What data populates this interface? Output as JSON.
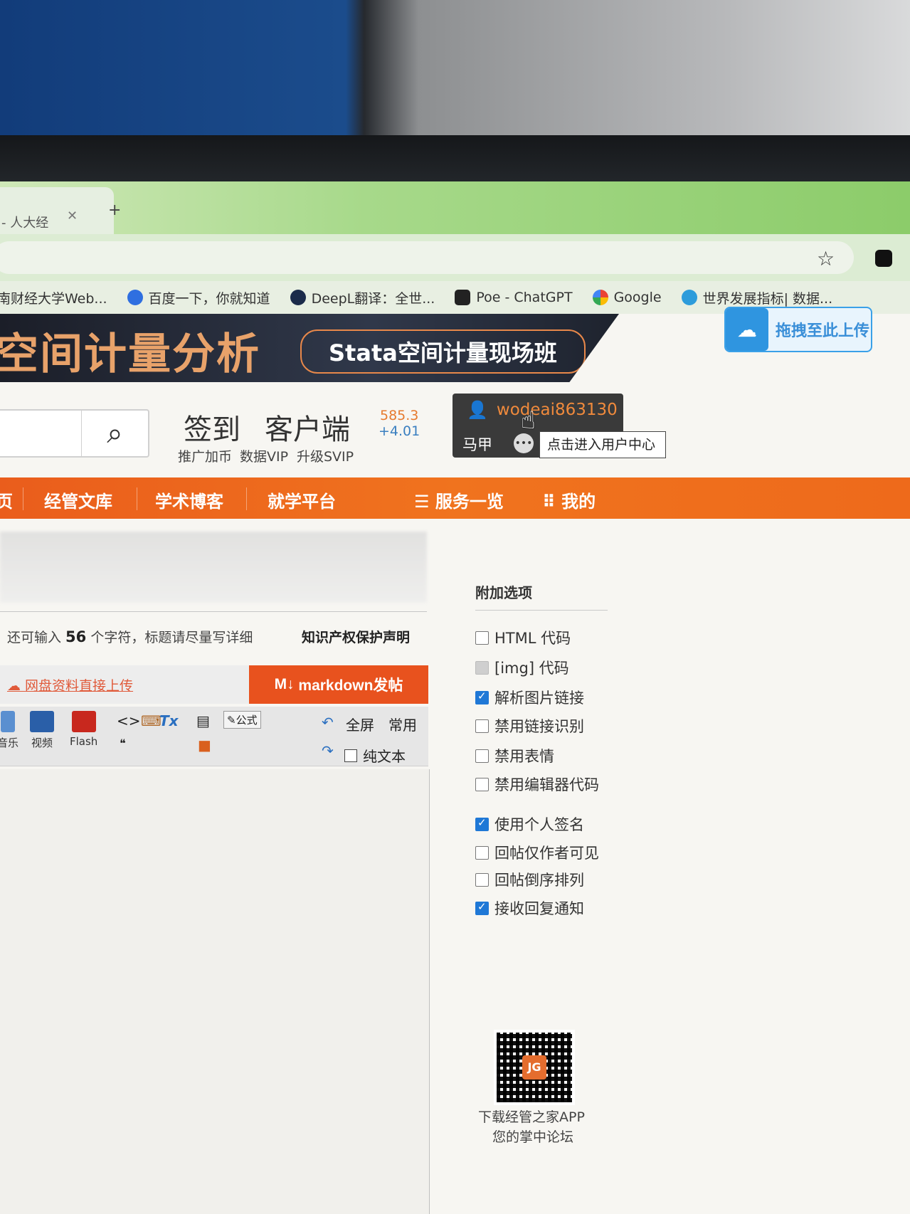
{
  "browser": {
    "tab_title": "- 人大经",
    "address_value": "",
    "bookmarks": [
      {
        "label": "南财经大学Web...",
        "icon": "school-icon",
        "color": "#c0392b"
      },
      {
        "label": "百度一下，你就知道",
        "icon": "baidu-paw-icon",
        "color": "#2f6fe0"
      },
      {
        "label": "DeepL翻译：全世...",
        "icon": "deepl-icon",
        "color": "#1b2b4a"
      },
      {
        "label": "Poe - ChatGPT",
        "icon": "poe-icon",
        "color": "#222222"
      },
      {
        "label": "Google",
        "icon": "google-icon",
        "color": "#4285f4"
      },
      {
        "label": "世界发展指标| 数据...",
        "icon": "globe-icon",
        "color": "#2d9cdb"
      }
    ]
  },
  "banner": {
    "title": "空间计量分析",
    "subtitle": "Stata空间计量现场班",
    "upload_label": "拖拽至此上传"
  },
  "header": {
    "signin": "签到",
    "client": "客户端",
    "promo": "推广加币",
    "data_vip": "数据VIP",
    "svip": "升级SVIP",
    "score": "585.3",
    "score_delta": "+4.01",
    "username": "wodeai863130",
    "majia": "马甲",
    "tooltip": "点击进入用户中心"
  },
  "nav": {
    "items": [
      "页",
      "经管文库",
      "学术博客",
      "就学平台",
      "服务一览",
      "我的"
    ]
  },
  "editor": {
    "char_hint_prefix": "还可输入 ",
    "char_count": "56",
    "char_hint_suffix": " 个字符，标题请尽量写详细",
    "ip_notice": "知识产权保护声明",
    "upload_link": "网盘资料直接上传",
    "markdown_button": "markdown发帖",
    "toolbar": {
      "music": "音乐",
      "video": "视频",
      "flash": "Flash",
      "formula": "公式",
      "fullscreen": "全屏",
      "common": "常用",
      "plain_text": "纯文本"
    }
  },
  "options": {
    "title": "附加选项",
    "items": [
      {
        "label": "HTML 代码",
        "state": "unchecked"
      },
      {
        "label": "[img] 代码",
        "state": "disabled"
      },
      {
        "label": "解析图片链接",
        "state": "checked"
      },
      {
        "label": "禁用链接识别",
        "state": "unchecked"
      },
      {
        "label": "禁用表情",
        "state": "unchecked"
      },
      {
        "label": "禁用编辑器代码",
        "state": "unchecked"
      },
      {
        "label": "使用个人签名",
        "state": "checked"
      },
      {
        "label": "回帖仅作者可见",
        "state": "unchecked"
      },
      {
        "label": "回帖倒序排列",
        "state": "unchecked"
      },
      {
        "label": "接收回复通知",
        "state": "checked"
      }
    ],
    "qr_line1": "下载经管之家APP",
    "qr_line2": "您的掌中论坛"
  }
}
